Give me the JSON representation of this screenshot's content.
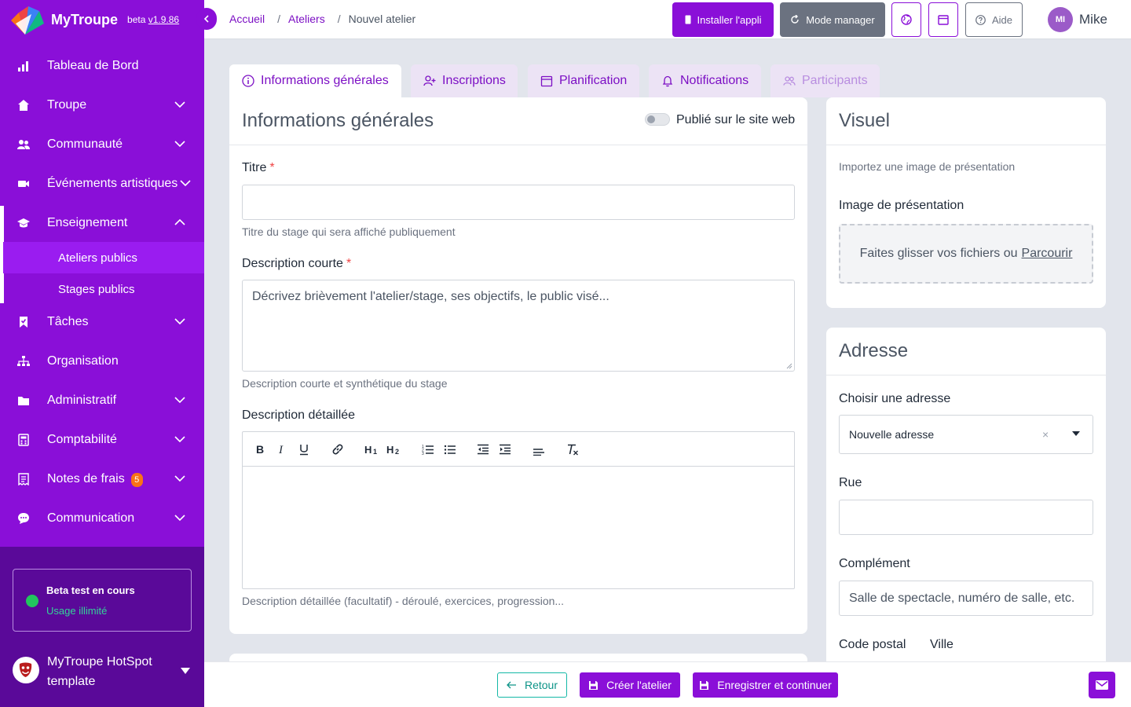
{
  "app": {
    "name": "MyTroupe",
    "version_prefix": "beta",
    "version": "v1.9.86"
  },
  "sidebar": {
    "items": [
      {
        "label": "Tableau de Bord"
      },
      {
        "label": "Troupe"
      },
      {
        "label": "Communauté"
      },
      {
        "label": "Événements artistiques"
      },
      {
        "label": "Enseignement"
      },
      {
        "label": "Tâches"
      },
      {
        "label": "Organisation"
      },
      {
        "label": "Administratif"
      },
      {
        "label": "Comptabilité"
      },
      {
        "label": "Notes de frais",
        "badge": "5"
      },
      {
        "label": "Communication"
      }
    ],
    "subitems": [
      {
        "label": "Ateliers publics"
      },
      {
        "label": "Stages publics"
      }
    ],
    "beta": {
      "title": "Beta test en cours",
      "subtitle": "Usage illimité"
    },
    "org": {
      "name": "MyTroupe HotSpot template"
    }
  },
  "topbar": {
    "breadcrumb": [
      "Accueil",
      "Ateliers",
      "Nouvel atelier"
    ],
    "separator": "/",
    "install_label": "Installer l'appli",
    "manager_label": "Mode manager",
    "help_label": "Aide",
    "user_initials": "MI",
    "user_name": "Mike"
  },
  "tabs": [
    {
      "label": "Informations générales"
    },
    {
      "label": "Inscriptions"
    },
    {
      "label": "Planification"
    },
    {
      "label": "Notifications"
    },
    {
      "label": "Participants"
    }
  ],
  "general": {
    "title": "Informations générales",
    "published_label": "Publié sur le site web",
    "titre_label": "Titre",
    "required_mark": "*",
    "titre_value": "",
    "titre_help": "Titre du stage qui sera affiché publiquement",
    "short_desc_label": "Description courte",
    "short_desc_placeholder": "Décrivez brièvement l'atelier/stage, ses objectifs, le public visé...",
    "short_desc_help": "Description courte et synthétique du stage",
    "long_desc_label": "Description détaillée",
    "long_desc_help": "Description détaillée (facultatif) - déroulé, exercices, progression..."
  },
  "visuel": {
    "title": "Visuel",
    "hint": "Importez une image de présentation",
    "image_label": "Image de présentation",
    "dropzone_text": "Faites glisser vos fichiers ou",
    "dropzone_link": "Parcourir"
  },
  "adresse": {
    "title": "Adresse",
    "choose_label": "Choisir une adresse",
    "choose_value": "Nouvelle adresse",
    "clear_glyph": "×",
    "rue_label": "Rue",
    "complement_label": "Complément",
    "complement_placeholder": "Salle de spectacle, numéro de salle, etc.",
    "cp_label": "Code postal",
    "ville_label": "Ville"
  },
  "footer": {
    "back_label": "Retour",
    "create_label": "Créer l'atelier",
    "save_label": "Enregistrer et continuer"
  },
  "colors": {
    "brand": "#8a0fd8",
    "brand_dark": "#5a0999",
    "accent_teal": "#14b8a6",
    "badge": "#f97316"
  }
}
